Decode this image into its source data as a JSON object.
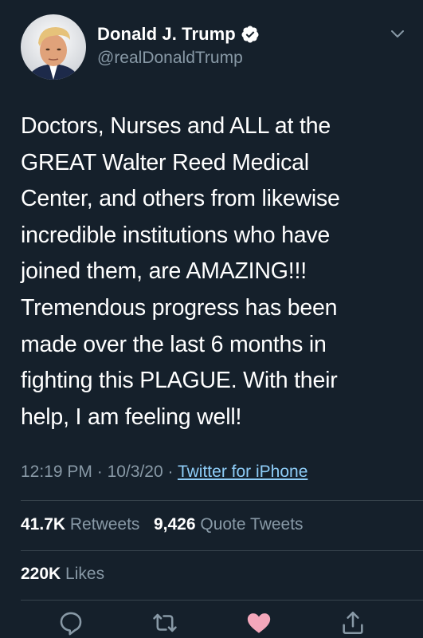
{
  "user": {
    "display_name": "Donald J. Trump",
    "handle": "@realDonaldTrump",
    "verified": true
  },
  "tweet": {
    "text": "Doctors, Nurses and ALL at the\nGREAT Walter Reed Medical\nCenter, and others from likewise\nincredible institutions who have\njoined them, are AMAZING!!!\nTremendous progress has been\nmade over the last 6 months in\nfighting this PLAGUE. With their\nhelp, I am feeling well!",
    "time": "12:19 PM",
    "separator1": "·",
    "date": "10/3/20",
    "separator2": "·",
    "source": "Twitter for iPhone"
  },
  "stats": {
    "retweets_count": "41.7K",
    "retweets_label": "Retweets",
    "quotes_count": "9,426",
    "quotes_label": "Quote Tweets",
    "likes_count": "220K",
    "likes_label": "Likes"
  },
  "actions": [
    "reply-icon",
    "retweet-icon",
    "like-icon",
    "share-icon"
  ],
  "colors": {
    "background": "#15202b",
    "secondary_text": "#8899a6",
    "link": "#8ecdf8",
    "divider": "#38444d",
    "like": "#f4a7bb"
  }
}
